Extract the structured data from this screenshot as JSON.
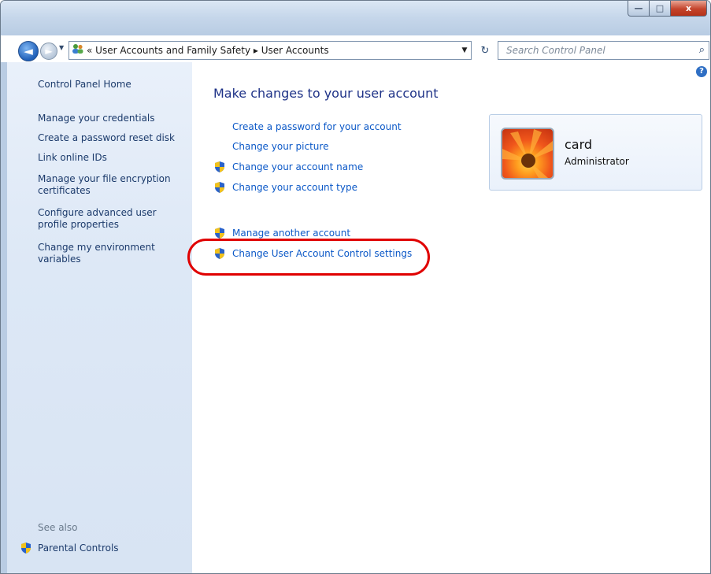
{
  "window": {
    "controls": {
      "minimize": "—",
      "maximize": "□",
      "close": "x"
    }
  },
  "nav": {
    "back": "◄",
    "forward": "►",
    "history": "▼",
    "breadcrumb": "«  User Accounts and Family Safety  ▸  User Accounts",
    "address_dropdown": "▼",
    "refresh": "↻",
    "search_placeholder": "Search Control Panel"
  },
  "sidebar": {
    "items": [
      "Control Panel Home",
      "Manage your credentials",
      "Create a password reset disk",
      "Link online IDs",
      "Manage your file encryption certificates",
      "Configure advanced user profile properties",
      "Change my environment variables"
    ],
    "see_also_label": "See also",
    "see_also_items": [
      "Parental Controls"
    ]
  },
  "main": {
    "help": "?",
    "heading": "Make changes to your user account",
    "tasks": [
      {
        "label": "Create a password for your account",
        "shield": false
      },
      {
        "label": "Change your picture",
        "shield": false
      },
      {
        "label": "Change your account name",
        "shield": true
      },
      {
        "label": "Change your account type",
        "shield": true
      }
    ],
    "other_tasks": [
      {
        "label": "Manage another account",
        "shield": true
      },
      {
        "label": "Change User Account Control settings",
        "shield": true
      }
    ]
  },
  "account": {
    "name": "card",
    "role": "Administrator"
  },
  "colors": {
    "link": "#0b58c7",
    "heading": "#1e3287",
    "sidebar_link": "#1b3a6b",
    "highlight": "#e00000"
  }
}
